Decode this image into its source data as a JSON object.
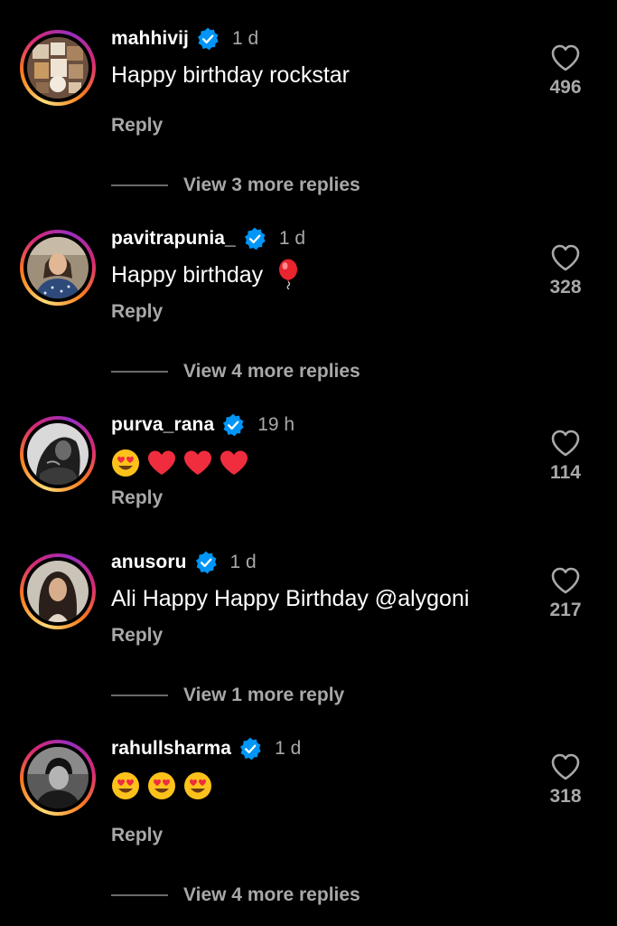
{
  "comments": [
    {
      "username": "mahhivij",
      "time": "1 d",
      "text": "Happy birthday rockstar",
      "reply_label": "Reply",
      "likes": "496",
      "view_more": "View 3 more replies",
      "avatar_icon": "photo-collage-avatar"
    },
    {
      "username": "pavitrapunia_",
      "time": "1 d",
      "text": "Happy birthday",
      "text_emoji": "balloon",
      "reply_label": "Reply",
      "likes": "328",
      "view_more": "View 4 more replies",
      "avatar_icon": "profile-photo-avatar"
    },
    {
      "username": "purva_rana",
      "time": "19 h",
      "text_emoji": "heart-eyes, red-heart, red-heart, red-heart",
      "reply_label": "Reply",
      "likes": "114",
      "avatar_icon": "bw-profile-avatar"
    },
    {
      "username": "anusoru",
      "time": "1 d",
      "text": "Ali Happy Happy Birthday @alygoni",
      "reply_label": "Reply",
      "likes": "217",
      "view_more": "View 1 more reply",
      "avatar_icon": "profile-photo-avatar"
    },
    {
      "username": "rahullsharma",
      "time": "1 d",
      "text_emoji": "heart-eyes, heart-eyes, heart-eyes",
      "reply_label": "Reply",
      "likes": "318",
      "view_more": "View 4 more replies",
      "avatar_icon": "bw-profile-avatar"
    }
  ],
  "colors": {
    "background": "#000000",
    "primary_text": "#ffffff",
    "secondary_text": "#a8a8a8",
    "verified_blue": "#0095f6",
    "heart_red": "#ff2d3a",
    "ring_gradient": [
      "#feda75",
      "#fa7e1e",
      "#d62976",
      "#962fbf"
    ]
  }
}
